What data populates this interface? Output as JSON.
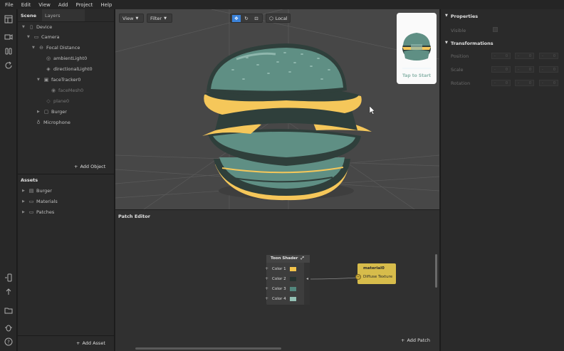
{
  "menu": [
    "File",
    "Edit",
    "View",
    "Add",
    "Project",
    "Help"
  ],
  "left_tabs": {
    "scene": "Scene",
    "layers": "Layers"
  },
  "scene_tree": [
    {
      "label": "Device",
      "icon": "phone-icon",
      "dim": false
    },
    {
      "label": "Camera",
      "icon": "camera-icon",
      "dim": false
    },
    {
      "label": "Focal Distance",
      "icon": "focal-icon",
      "dim": false
    },
    {
      "label": "ambientLight0",
      "icon": "light-icon",
      "dim": false
    },
    {
      "label": "directionalLight0",
      "icon": "light-icon",
      "dim": false
    },
    {
      "label": "faceTracker0",
      "icon": "face-tracker-icon",
      "dim": false
    },
    {
      "label": "faceMesh0",
      "icon": "mesh-icon",
      "dim": true
    },
    {
      "label": "plane0",
      "icon": "plane-icon",
      "dim": true
    },
    {
      "label": "Burger",
      "icon": "cube-icon",
      "dim": false
    },
    {
      "label": "Microphone",
      "icon": "microphone-icon",
      "dim": false
    }
  ],
  "add_object": "Add Object",
  "assets_title": "Assets",
  "assets": [
    {
      "label": "Burger",
      "icon": "file-icon"
    },
    {
      "label": "Materials",
      "icon": "folder-icon"
    },
    {
      "label": "Patches",
      "icon": "folder-icon"
    }
  ],
  "add_asset": "Add Asset",
  "viewport": {
    "view": "View",
    "filter": "Filter",
    "local": "Local",
    "preview_caption": "Tap to Start",
    "colors": {
      "bun": "#5f8f84",
      "bun_dark": "#2f3f3b",
      "cheese": "#f5c75a",
      "sesame": "#8fb7ad"
    }
  },
  "patch_editor": {
    "title": "Patch Editor",
    "node_title": "Toon Shader",
    "colors": [
      {
        "label": "Color 1",
        "swatch": "#f3c34a"
      },
      {
        "label": "Color 2",
        "swatch": "#263330"
      },
      {
        "label": "Color 3",
        "swatch": "#52877d"
      },
      {
        "label": "Color 4",
        "swatch": "#93c0b4"
      }
    ],
    "material_title": "material0",
    "material_input": "Diffuse Texture",
    "add_patch": "Add Patch"
  },
  "properties": {
    "title": "Properties",
    "visible": "Visible",
    "transformations": "Transformations",
    "rows": [
      "Position",
      "Scale",
      "Rotation"
    ]
  }
}
